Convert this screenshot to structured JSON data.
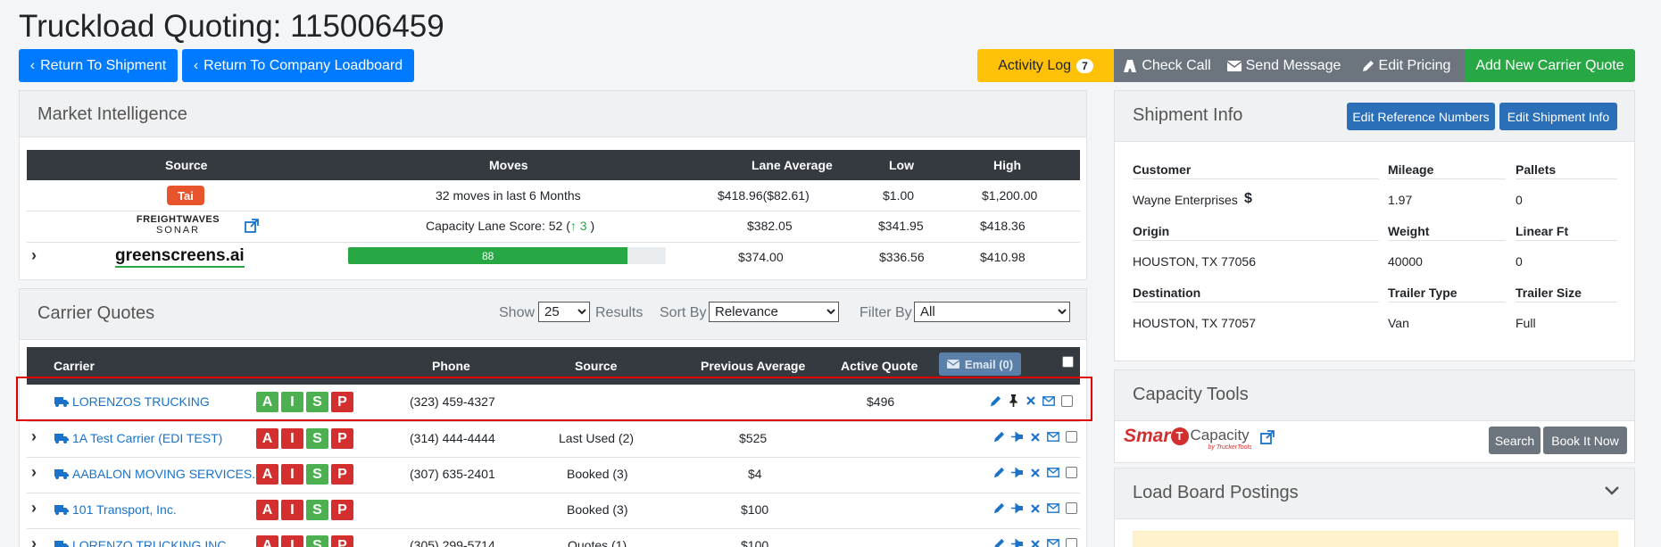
{
  "page": {
    "title": "Truckload Quoting: 115006459"
  },
  "nav": {
    "return_shipment": "Return To Shipment",
    "return_loadboard": "Return To Company Loadboard"
  },
  "toolbar": {
    "activity_log": "Activity Log",
    "activity_count": "7",
    "check_call": "Check Call",
    "send_message": "Send Message",
    "edit_pricing": "Edit Pricing",
    "add_quote": "Add New Carrier Quote"
  },
  "market": {
    "title": "Market Intelligence",
    "headers": [
      "Source",
      "Moves",
      "Lane Average",
      "Low",
      "High"
    ],
    "rows": [
      {
        "source": "Tai",
        "moves": "32 moves in last 6 Months",
        "lane_avg": "$418.96($82.61)",
        "low": "$1.00",
        "high": "$1,200.00"
      },
      {
        "source": "FREIGHTWAVES SONAR",
        "source_top": "FREIGHTWAVES",
        "source_bottom": "SONAR",
        "moves_prefix": "Capacity Lane Score: 52 (",
        "moves_delta": "3",
        "moves_suffix": ")",
        "lane_avg": "$382.05",
        "low": "$341.95",
        "high": "$418.36"
      },
      {
        "source": "greenscreens.ai",
        "score": "88",
        "score_fraction": 0.88,
        "lane_avg": "$374.00",
        "low": "$336.56",
        "high": "$410.98"
      }
    ]
  },
  "quotes": {
    "title": "Carrier Quotes",
    "show_label": "Show",
    "show_value": "25",
    "results_label": "Results",
    "sort_label": "Sort By",
    "sort_value": "Relevance",
    "filter_label": "Filter By",
    "filter_value": "All",
    "email_button": "Email (0)",
    "headers": [
      "Carrier",
      "Phone",
      "Source",
      "Previous Average",
      "Active Quote"
    ],
    "aisp": [
      "A",
      "I",
      "S",
      "P"
    ],
    "rows": [
      {
        "carrier": "LORENZOS TRUCKING",
        "phone": "(323) 459-4327",
        "source": "",
        "prev_avg": "",
        "active": "$496"
      },
      {
        "carrier": "1A Test Carrier (EDI TEST)",
        "phone": "(314) 444-4444",
        "source": "Last Used (2)",
        "prev_avg": "$525",
        "active": ""
      },
      {
        "carrier": "AABALON MOVING SERVICES....",
        "phone": "(307) 635-2401",
        "source": "Booked (3)",
        "prev_avg": "$4",
        "active": ""
      },
      {
        "carrier": "101 Transport, Inc.",
        "phone": "",
        "source": "Booked (3)",
        "prev_avg": "$100",
        "active": ""
      },
      {
        "carrier": "LORENZO TRUCKING INC",
        "phone": "(305) 299-5714",
        "source": "Quotes (1)",
        "prev_avg": "$100",
        "active": ""
      }
    ]
  },
  "shipment": {
    "title": "Shipment Info",
    "edit_refs": "Edit Reference Numbers",
    "edit_info": "Edit Shipment Info",
    "customer_label": "Customer",
    "customer": "Wayne Enterprises",
    "customer_symbol": "$",
    "mileage_label": "Mileage",
    "mileage": "1.97",
    "pallets_label": "Pallets",
    "pallets": "0",
    "origin_label": "Origin",
    "origin": "HOUSTON, TX 77056",
    "weight_label": "Weight",
    "weight": "40000",
    "linear_label": "Linear Ft",
    "linear": "0",
    "dest_label": "Destination",
    "dest": "HOUSTON, TX 77057",
    "trailer_type_label": "Trailer Type",
    "trailer_type": "Van",
    "trailer_size_label": "Trailer Size",
    "trailer_size": "Full"
  },
  "capacity": {
    "title": "Capacity Tools",
    "logo_smart": "Smar",
    "logo_capacity": "Capacity",
    "logo_by": "by TruckerTools",
    "search": "Search",
    "book": "Book It Now"
  },
  "loadboard": {
    "title": "Load Board Postings"
  },
  "colors": {
    "primary": "#007bff",
    "warning": "#ffc107",
    "success": "#28a745",
    "danger": "#d32f2f",
    "highlight": "#e00000"
  }
}
